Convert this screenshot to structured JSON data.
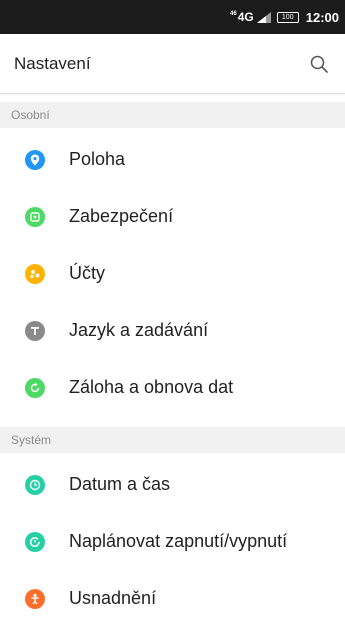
{
  "status_bar": {
    "network": "4G",
    "network_sup": "46",
    "battery": "100",
    "time": "12:00"
  },
  "app_bar": {
    "title": "Nastavení",
    "search_icon": "search-icon"
  },
  "sections": [
    {
      "header": "Osobní",
      "items": [
        {
          "label": "Poloha",
          "icon": "location-icon",
          "color": "#2196f3"
        },
        {
          "label": "Zabezpečení",
          "icon": "security-icon",
          "color": "#4cd964"
        },
        {
          "label": "Účty",
          "icon": "accounts-icon",
          "color": "#ffb300"
        },
        {
          "label": "Jazyk a zadávání",
          "icon": "language-icon",
          "color": "#8a8a8a"
        },
        {
          "label": "Záloha a obnova dat",
          "icon": "backup-icon",
          "color": "#4cd964"
        }
      ]
    },
    {
      "header": "Systém",
      "items": [
        {
          "label": "Datum a čas",
          "icon": "clock-icon",
          "color": "#26d0a5"
        },
        {
          "label": "Naplánovat zapnutí/vypnutí",
          "icon": "schedule-power-icon",
          "color": "#26d0a5"
        },
        {
          "label": "Usnadnění",
          "icon": "accessibility-icon",
          "color": "#ff6d2d"
        }
      ]
    }
  ]
}
